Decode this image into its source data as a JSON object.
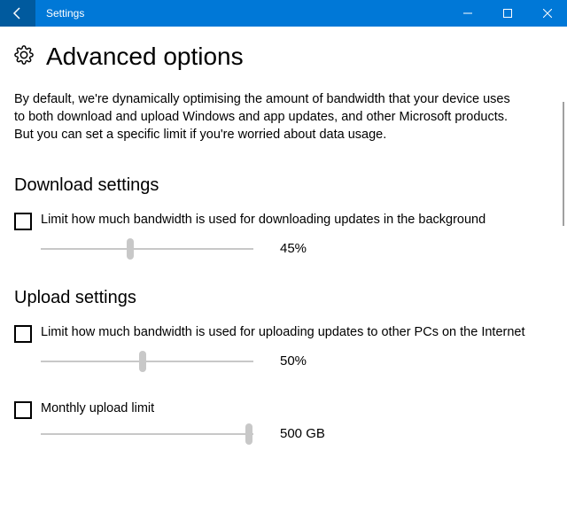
{
  "header": {
    "app_title": "Settings",
    "page_title": "Advanced options"
  },
  "intro": "By default, we're dynamically optimising the amount of bandwidth that your device uses to both download and upload Windows and app updates, and other Microsoft products. But you can set a specific limit if you're worried about data usage.",
  "download": {
    "section_title": "Download settings",
    "limit_label": "Limit how much bandwidth is used for downloading updates in the background",
    "slider_value": "45%",
    "slider_pct": 42
  },
  "upload": {
    "section_title": "Upload settings",
    "limit_label": "Limit how much bandwidth is used for uploading updates to other PCs on the Internet",
    "slider_value": "50%",
    "slider_pct": 48,
    "monthly_label": "Monthly upload limit",
    "monthly_value": "500 GB",
    "monthly_pct": 98
  },
  "colors": {
    "accent": "#0078d7",
    "accent_dark": "#005a9e"
  }
}
